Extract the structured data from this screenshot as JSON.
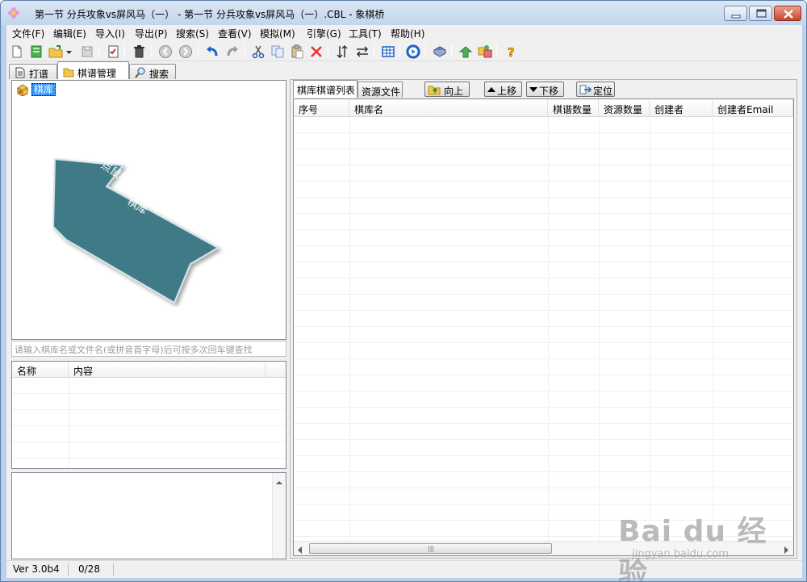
{
  "window": {
    "title": "第一节  分兵攻象vs屏风马（一） - 第一节  分兵攻象vs屏风马（一）.CBL - 象棋桥"
  },
  "menu": [
    "文件(F)",
    "编辑(E)",
    "导入(I)",
    "导出(P)",
    "搜索(S)",
    "查看(V)",
    "模拟(M)",
    "引擎(G)",
    "工具(T)",
    "帮助(H)"
  ],
  "toolbar_icons": [
    "new-file-icon",
    "new-book-icon",
    "open-folder-icon",
    "dropdown-icon",
    "save-icon",
    "properties-icon",
    "delete-icon",
    "back-icon",
    "forward-icon",
    "undo-icon",
    "redo-icon",
    "cut-icon",
    "copy-icon",
    "paste-icon",
    "remove-icon",
    "sort-icon",
    "swap-icon",
    "board-icon",
    "play-icon",
    "book-icon",
    "upload-icon",
    "sync-icon",
    "help-icon"
  ],
  "main_tabs": [
    {
      "label": "打谱",
      "icon": "document-icon"
    },
    {
      "label": "棋谱管理",
      "icon": "folder-icon"
    },
    {
      "label": "搜索",
      "icon": "magnifier-icon"
    }
  ],
  "active_main_tab": 1,
  "tree": {
    "root_label": "棋库",
    "annotation": "点鼠标右键，选择新建棋库"
  },
  "search": {
    "placeholder": "请输入棋库名或文件名(或拼音首字母)后可按多次回车键查找"
  },
  "properties": {
    "columns": [
      "名称",
      "内容"
    ]
  },
  "right_tabs": [
    "棋库棋谱列表",
    "资源文件"
  ],
  "right_buttons": {
    "up_level": "向上",
    "move_up": "上移",
    "move_down": "下移",
    "locate": "定位"
  },
  "list": {
    "columns": [
      "序号",
      "棋库名",
      "棋谱数量",
      "资源数量",
      "创建者",
      "创建者Email"
    ]
  },
  "status": {
    "version": "Ver 3.0b4",
    "count": "0/28"
  },
  "watermark": {
    "logo": "Bai du 经验",
    "url": "jingyan.baidu.com"
  },
  "colors": {
    "arrow_fill": "#3f7a86",
    "selection": "#3399ff",
    "title_bg": "#c9daef"
  }
}
